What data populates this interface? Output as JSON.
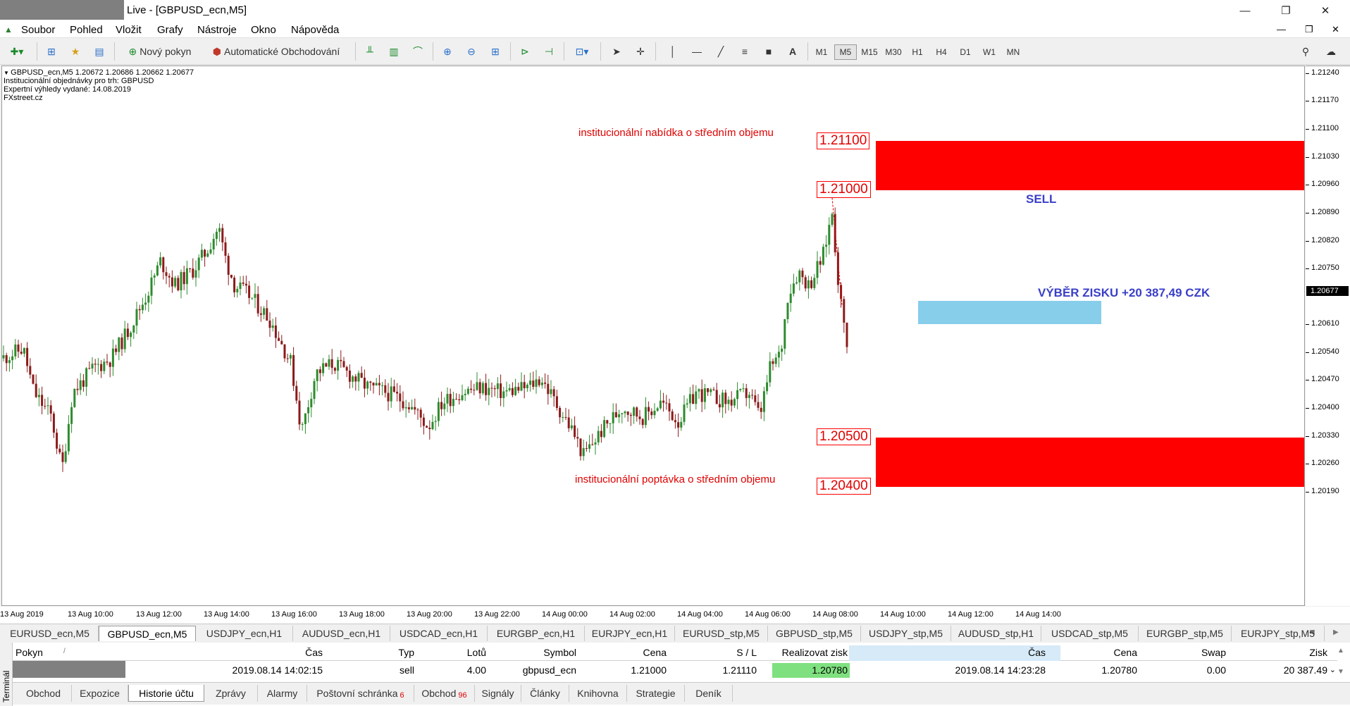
{
  "window": {
    "title": "Live - [GBPUSD_ecn,M5]",
    "minimize": "—",
    "maximize": "❐",
    "close": "✕"
  },
  "menu": [
    "Soubor",
    "Pohled",
    "Vložit",
    "Grafy",
    "Nástroje",
    "Okno",
    "Nápověda"
  ],
  "toolbar": {
    "new_order": "Nový pokyn",
    "auto_trading": "Automatické Obchodování",
    "font_tool": "A",
    "timeframes": [
      "M1",
      "M5",
      "M15",
      "M30",
      "H1",
      "H4",
      "D1",
      "W1",
      "MN"
    ],
    "active_timeframe": "M5"
  },
  "chart_info": {
    "line1": "GBPUSD_ecn,M5  1.20672 1.20686 1.20662 1.20677",
    "line2": "Institucionální objednávky pro trh: GBPUSD",
    "line3": "Expertní výhledy vydané: 14.08.2019",
    "line4": "FXstreet.cz"
  },
  "annotations": {
    "supply_label": "institucionální nabídka o středním objemu",
    "demand_label": "institucionální poptávka o středním objemu",
    "sell_label": "SELL",
    "tp_label": "VÝBĚR ZISKU +20 387,49 CZK",
    "supply_top": "1.21100",
    "supply_bottom": "1.21000",
    "demand_top": "1.20500",
    "demand_bottom": "1.20400"
  },
  "price_axis": {
    "labels": [
      "1.21240",
      "1.21170",
      "1.21100",
      "1.21030",
      "1.20960",
      "1.20890",
      "1.20820",
      "1.20750",
      "1.20610",
      "1.20540",
      "1.20470",
      "1.20400",
      "1.20330",
      "1.20260",
      "1.20190"
    ],
    "current": "1.20677"
  },
  "time_axis": [
    "13 Aug 2019",
    "13 Aug 10:00",
    "13 Aug 12:00",
    "13 Aug 14:00",
    "13 Aug 16:00",
    "13 Aug 18:00",
    "13 Aug 20:00",
    "13 Aug 22:00",
    "14 Aug 00:00",
    "14 Aug 02:00",
    "14 Aug 04:00",
    "14 Aug 06:00",
    "14 Aug 08:00",
    "14 Aug 10:00",
    "14 Aug 12:00",
    "14 Aug 14:00"
  ],
  "symbol_tabs": [
    "EURUSD_ecn,M5",
    "GBPUSD_ecn,M5",
    "USDJPY_ecn,H1",
    "AUDUSD_ecn,H1",
    "USDCAD_ecn,H1",
    "EURGBP_ecn,H1",
    "EURJPY_ecn,H1",
    "EURUSD_stp,M5",
    "GBPUSD_stp,M5",
    "USDJPY_stp,M5",
    "AUDUSD_stp,H1",
    "USDCAD_stp,M5",
    "EURGBP_stp,M5",
    "EURJPY_stp,M5"
  ],
  "active_symbol_tab": "GBPUSD_ecn,M5",
  "terminal": {
    "side_label": "Terminál",
    "headers": [
      "Pokyn",
      "Čas",
      "Typ",
      "Lotů",
      "Symbol",
      "Cena",
      "S / L",
      "Realizovat zisk",
      "Čas",
      "Cena",
      "Swap",
      "Zisk"
    ],
    "row": [
      "",
      "2019.08.14 14:02:15",
      "sell",
      "4.00",
      "gbpusd_ecn",
      "1.21000",
      "1.21110",
      "1.20780",
      "2019.08.14 14:23:28",
      "1.20780",
      "0.00",
      "20 387.49"
    ],
    "tabs": [
      {
        "label": "Obchod",
        "badge": ""
      },
      {
        "label": "Expozice",
        "badge": ""
      },
      {
        "label": "Historie účtu",
        "badge": ""
      },
      {
        "label": "Zprávy",
        "badge": ""
      },
      {
        "label": "Alarmy",
        "badge": ""
      },
      {
        "label": "Poštovní schránka",
        "badge": "6"
      },
      {
        "label": "Obchod",
        "badge": "96"
      },
      {
        "label": "Signály",
        "badge": ""
      },
      {
        "label": "Články",
        "badge": ""
      },
      {
        "label": "Knihovna",
        "badge": ""
      },
      {
        "label": "Strategie",
        "badge": ""
      },
      {
        "label": "Deník",
        "badge": ""
      }
    ],
    "active_tab": "Historie účtu"
  },
  "colors": {
    "bull": "#2e8b2e",
    "bear": "#8b1a1a",
    "zone": "#ff0000",
    "tp_zone": "#87ceeb",
    "annotation_blue": "#3a3fc8"
  },
  "chart_data": {
    "type": "candlestick",
    "symbol": "GBPUSD_ecn",
    "timeframe": "M5",
    "ylim": [
      1.2016,
      1.2127
    ],
    "supply_zone": [
      1.21,
      1.211
    ],
    "demand_zone": [
      1.204,
      1.205
    ],
    "take_profit_zone": [
      1.20735,
      1.2078
    ],
    "trade": {
      "side": "sell",
      "entry": 1.21,
      "exit": 1.2078
    },
    "path": [
      [
        0,
        1.2067
      ],
      [
        30,
        1.2069
      ],
      [
        45,
        1.206
      ],
      [
        70,
        1.2055
      ],
      [
        85,
        1.2044
      ],
      [
        100,
        1.206
      ],
      [
        130,
        1.2065
      ],
      [
        155,
        1.2067
      ],
      [
        180,
        1.2073
      ],
      [
        205,
        1.208
      ],
      [
        225,
        1.2087
      ],
      [
        245,
        1.2082
      ],
      [
        270,
        1.2085
      ],
      [
        290,
        1.2089
      ],
      [
        307,
        1.2094
      ],
      [
        318,
        1.2087
      ],
      [
        330,
        1.2082
      ],
      [
        350,
        1.208
      ],
      [
        380,
        1.2075
      ],
      [
        410,
        1.2066
      ],
      [
        425,
        1.2052
      ],
      [
        445,
        1.2064
      ],
      [
        470,
        1.2066
      ],
      [
        500,
        1.2063
      ],
      [
        520,
        1.2061
      ],
      [
        545,
        1.206
      ],
      [
        575,
        1.2058
      ],
      [
        605,
        1.2053
      ],
      [
        625,
        1.2058
      ],
      [
        650,
        1.206
      ],
      [
        680,
        1.2061
      ],
      [
        710,
        1.206
      ],
      [
        745,
        1.2061
      ],
      [
        765,
        1.2063
      ],
      [
        785,
        1.2058
      ],
      [
        810,
        1.2052
      ],
      [
        825,
        1.2047
      ],
      [
        850,
        1.2052
      ],
      [
        880,
        1.2057
      ],
      [
        910,
        1.2055
      ],
      [
        935,
        1.2058
      ],
      [
        960,
        1.2054
      ],
      [
        985,
        1.206
      ],
      [
        1010,
        1.2059
      ],
      [
        1030,
        1.2058
      ],
      [
        1060,
        1.206
      ],
      [
        1075,
        1.2055
      ],
      [
        1090,
        1.2065
      ],
      [
        1105,
        1.2068
      ],
      [
        1115,
        1.208
      ],
      [
        1130,
        1.2085
      ],
      [
        1145,
        1.2082
      ],
      [
        1165,
        1.2088
      ],
      [
        1178,
        1.2097
      ],
      [
        1186,
        1.2084
      ],
      [
        1193,
        1.2075
      ],
      [
        1203,
        1.2068
      ]
    ]
  }
}
